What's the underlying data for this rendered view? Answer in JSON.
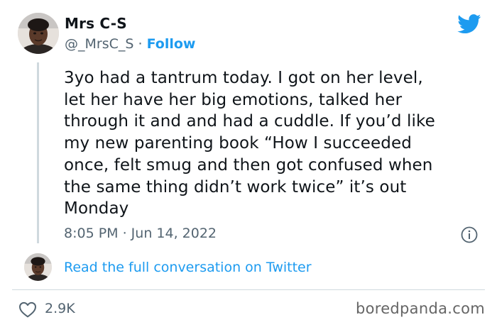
{
  "author": {
    "display_name": "Mrs C-S",
    "handle": "@_MrsC_S",
    "separator": "·",
    "follow_label": "Follow"
  },
  "tweet": {
    "lines": [
      "3yo had a tantrum today. I got on her level,",
      "let her have her big emotions, talked her",
      "through it and and had a cuddle. If you’d like",
      "my new parenting book “How I succeeded",
      "once, felt smug and then got confused when",
      "the same thing didn’t work twice” it’s out",
      "Monday"
    ],
    "timestamp": "8:05 PM · Jun 14, 2022"
  },
  "conversation_link": "Read the full conversation on Twitter",
  "engagement": {
    "likes": "2.9K"
  },
  "watermark": "boredpanda.com",
  "icons": {
    "logo": "twitter-bird-icon",
    "info": "info-icon",
    "like": "heart-icon"
  },
  "colors": {
    "accent": "#1d9bf0",
    "text": "#0f1419",
    "secondary": "#536471",
    "divider": "#cfd9de"
  }
}
